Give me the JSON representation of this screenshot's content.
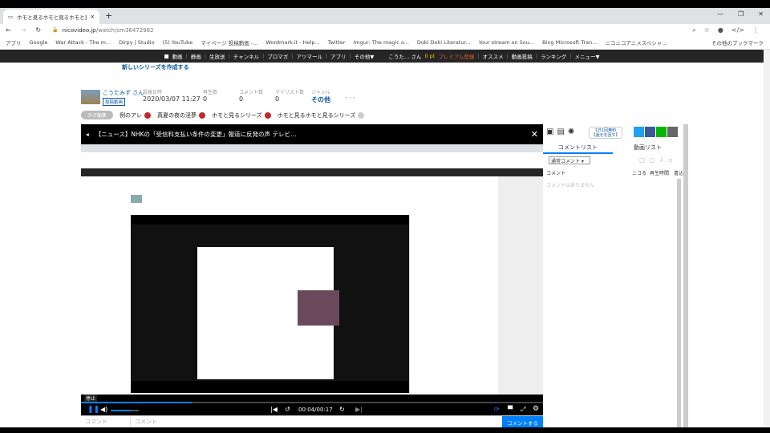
{
  "browser": {
    "tab_title": "ホモと見るホモと見るホモと見るシリー",
    "url_domain": "nicovideo.jp",
    "url_path": "/watch/sm36472982",
    "bookmarks": [
      "アプリ",
      "Google",
      "War Attack - The m...",
      "Dirpy | Studio",
      "(5) YouTube",
      "マイページ 投稿動画 -...",
      "Wordmark.it - Help...",
      "Twitter",
      "Imgur: The magic o...",
      "Doki Doki Literatur...",
      "Your stream on Sou...",
      "Bing Microsoft Tran...",
      "ニコニコアニメスペシャ..."
    ],
    "other_bookmarks": "その他のブックマーク"
  },
  "nav": {
    "items": [
      "動画",
      "静画",
      "生放送",
      "チャンネル",
      "ブロマガ",
      "アツマール",
      "アプリ",
      "その他▼"
    ],
    "user": "こうた… さん",
    "points": "0 pt",
    "premium": "プレミアム登録",
    "right_items": [
      "オススメ",
      "動画投稿",
      "ランキング",
      "メニュー▼"
    ]
  },
  "series_link": "新しいシリーズを作成する",
  "uploader": {
    "name": "こうたみず さん",
    "badge": "投稿動画"
  },
  "stats": [
    {
      "label": "投稿日時",
      "value": "2020/03/07 11:27"
    },
    {
      "label": "再生数",
      "value": "0"
    },
    {
      "label": "コメント数",
      "value": "0"
    },
    {
      "label": "マイリスト数",
      "value": "0"
    },
    {
      "label": "ジャンル",
      "value": "その他"
    }
  ],
  "more": "･･･",
  "tags": {
    "edit": "タグ編集",
    "items": [
      "例のアレ",
      "真夏の夜の淫夢",
      "ホモと見るシリーズ",
      "ホモと見るホモと見るシリーズ"
    ]
  },
  "player": {
    "headline": "【ニュース】NHKの「受信料支払い条件の変更」報道に反発の声 テレビ…",
    "tooltip": "停止",
    "time": "00:04/00:17",
    "progress": 0.24,
    "volume": 0.7,
    "command_placeholder": "コマンド",
    "comment_placeholder": "コメント",
    "submit": "コメントする"
  },
  "panel": {
    "promo": "1日1回無料\n【還元を回す】",
    "tabs": [
      "コメントリスト",
      "動画リスト"
    ],
    "filter": "通常コメント",
    "columns": [
      "コメント",
      "ニコる",
      "再生時間",
      "書込"
    ],
    "empty": "コメントはありません"
  },
  "colors": {
    "accent": "#0080ff",
    "nav": "#252525",
    "premium": "#e06030",
    "link": "#0a5aa0"
  }
}
